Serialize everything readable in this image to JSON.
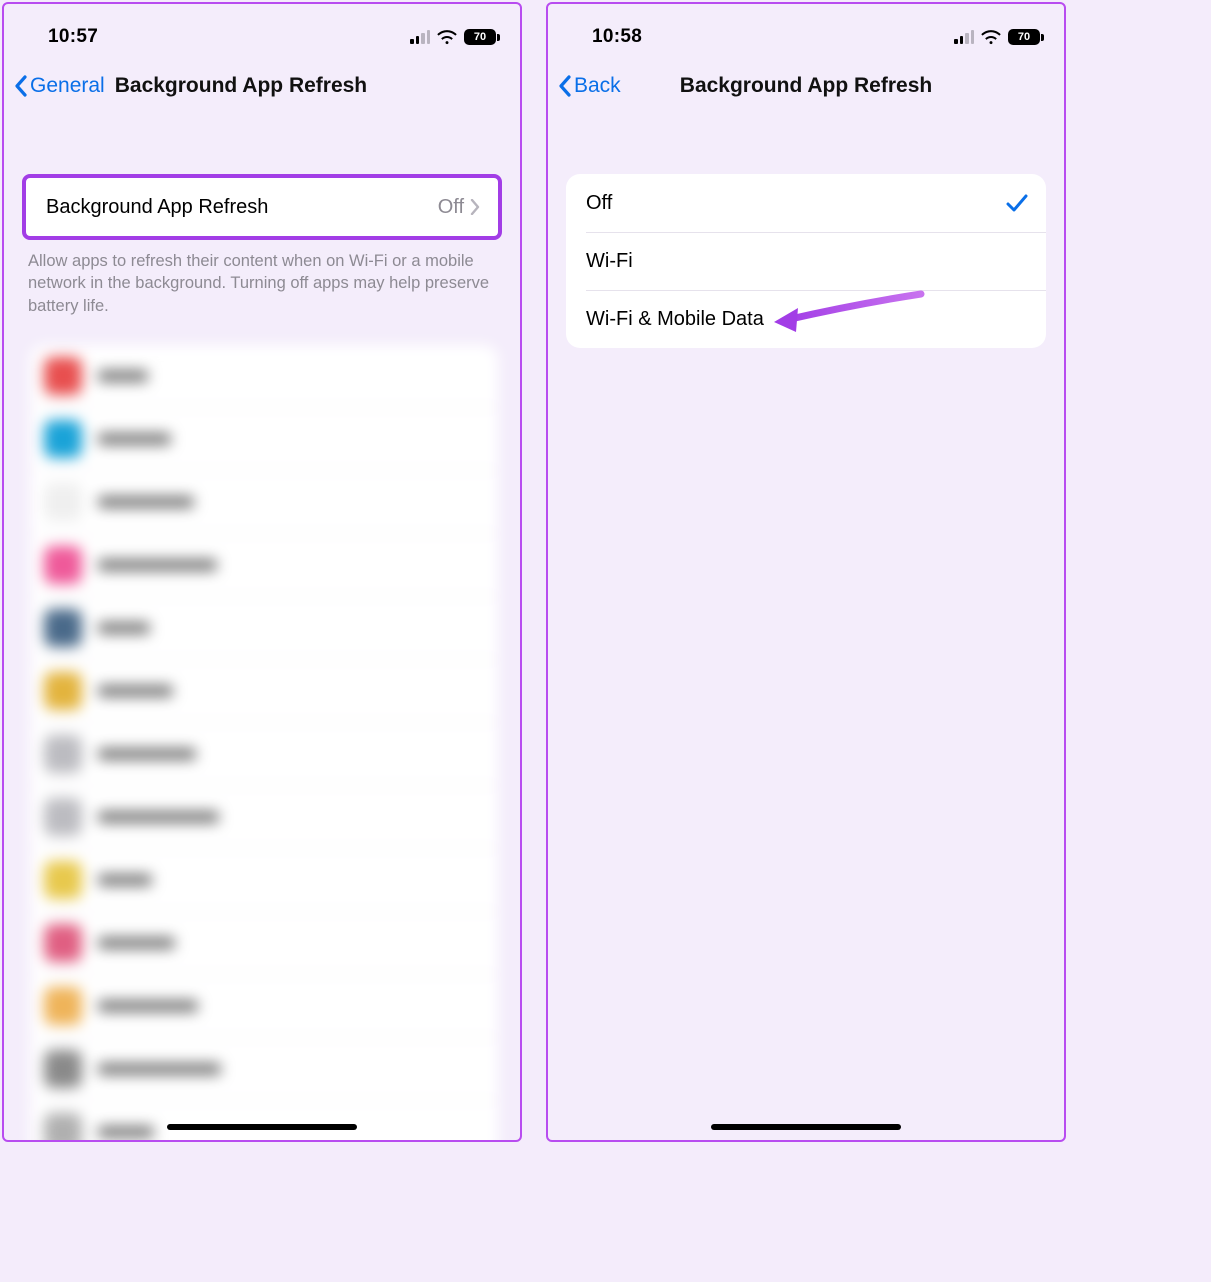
{
  "left": {
    "status": {
      "time": "10:57",
      "battery": "70"
    },
    "nav": {
      "back_label": "General",
      "title": "Background App Refresh"
    },
    "main_row": {
      "label": "Background App Refresh",
      "value": "Off"
    },
    "footer": "Allow apps to refresh their content when on Wi-Fi or a mobile network in the background. Turning off apps may help preserve battery life."
  },
  "right": {
    "status": {
      "time": "10:58",
      "battery": "70"
    },
    "nav": {
      "back_label": "Back",
      "title": "Background App Refresh"
    },
    "options": [
      {
        "label": "Off",
        "selected": true
      },
      {
        "label": "Wi-Fi",
        "selected": false
      },
      {
        "label": "Wi-Fi & Mobile Data",
        "selected": false
      }
    ]
  },
  "blur_app_colors": [
    "#e84f4f",
    "#1aa3d8",
    "#efefef",
    "#ef5a9a",
    "#4a6a8a",
    "#e3b43e",
    "#bcbcc1",
    "#bcbcc1",
    "#e8c94d",
    "#e05f82",
    "#efb45a",
    "#8a8a8a",
    "#b0b0b0"
  ]
}
